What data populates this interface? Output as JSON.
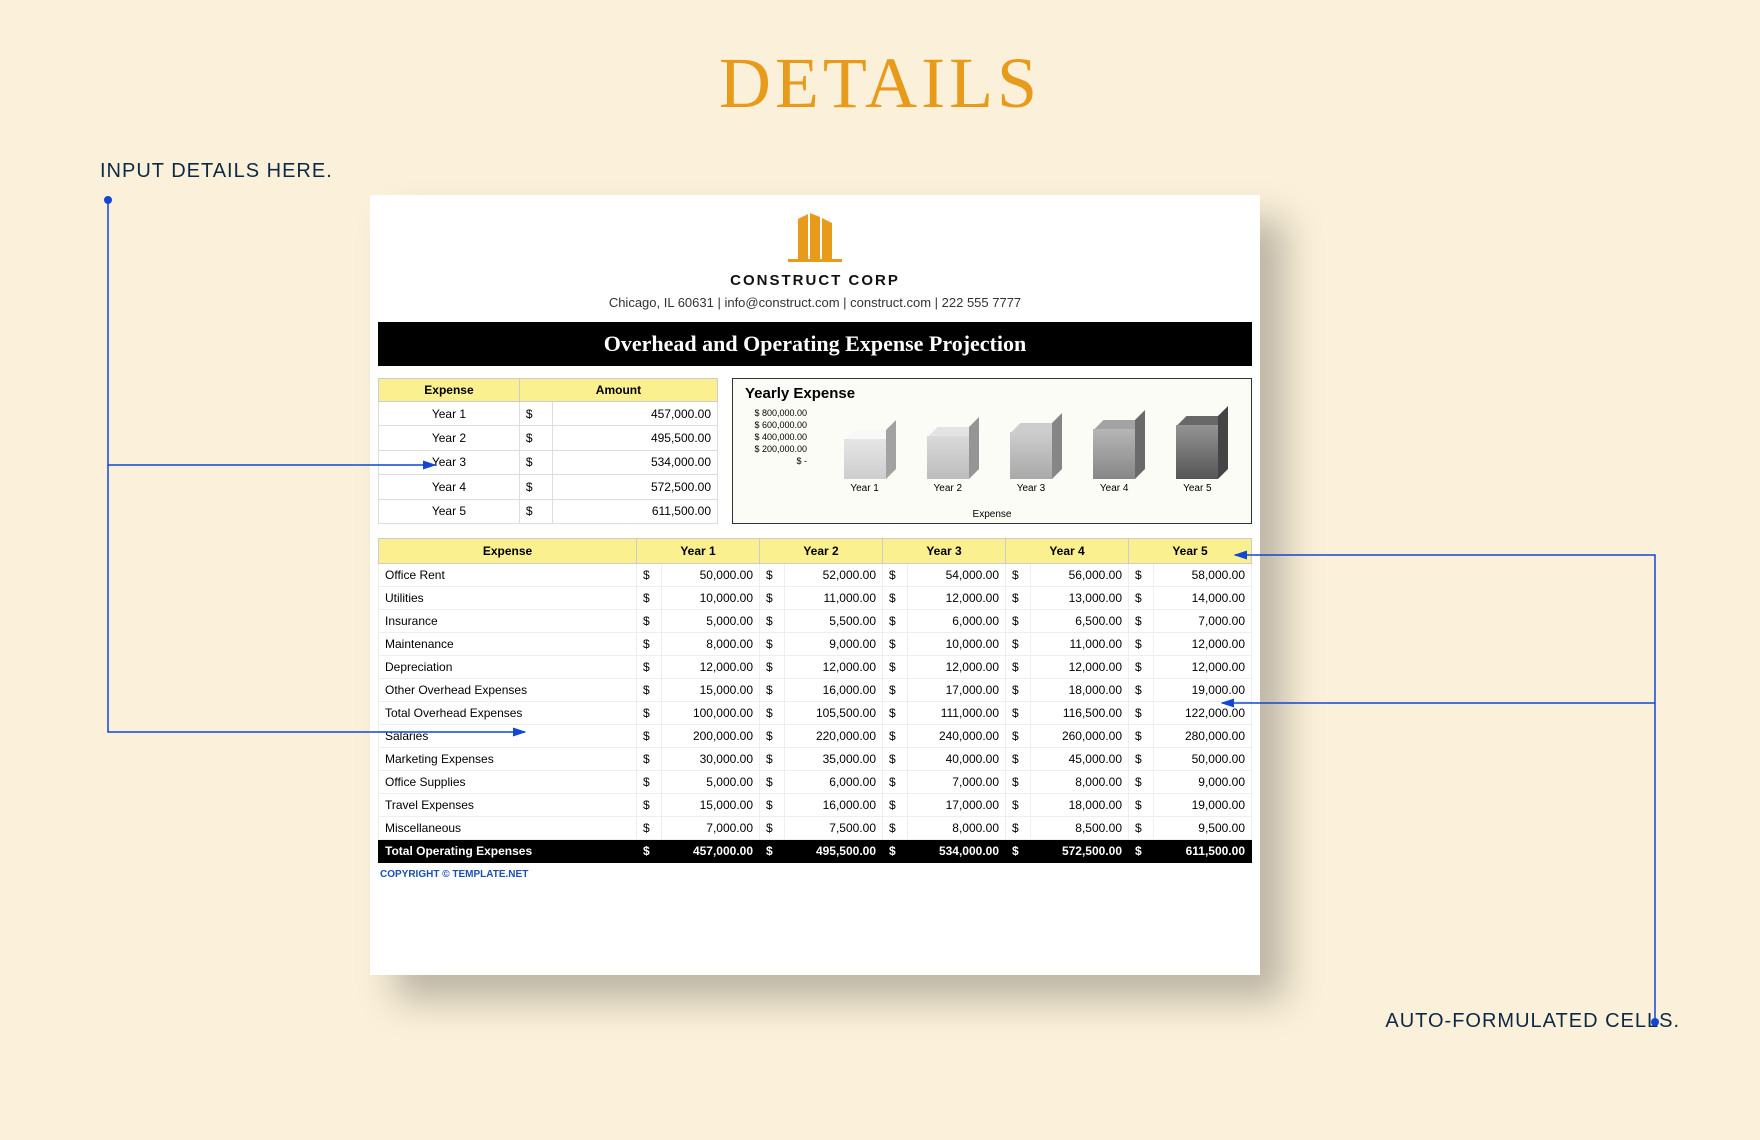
{
  "page": {
    "title": "DETAILS"
  },
  "annotations": {
    "input": "INPUT DETAILS HERE.",
    "auto": "AUTO-FORMULATED CELLS."
  },
  "company": {
    "name": "CONSTRUCT CORP",
    "line": "Chicago, IL 60631  |  info@construct.com  |  construct.com  |  222 555 7777"
  },
  "titleBar": "Overhead and Operating Expense Projection",
  "yearly": {
    "headers": {
      "expense": "Expense",
      "amount": "Amount"
    },
    "rows": [
      {
        "label": "Year 1",
        "amount": "457,000.00"
      },
      {
        "label": "Year 2",
        "amount": "495,500.00"
      },
      {
        "label": "Year 3",
        "amount": "534,000.00"
      },
      {
        "label": "Year 4",
        "amount": "572,500.00"
      },
      {
        "label": "Year 5",
        "amount": "611,500.00"
      }
    ]
  },
  "chart": {
    "title": "Yearly Expense",
    "sub": "Expense",
    "ticks": [
      "$ 800,000.00",
      "$ 600,000.00",
      "$ 400,000.00",
      "$ 200,000.00",
      "$ -"
    ]
  },
  "chart_data": {
    "type": "bar",
    "title": "Yearly Expense",
    "categories": [
      "Year 1",
      "Year 2",
      "Year 3",
      "Year 4",
      "Year 5"
    ],
    "values": [
      457000,
      495500,
      534000,
      572500,
      611500
    ],
    "ylabel": "Expense",
    "xlabel": "",
    "ylim": [
      0,
      800000
    ]
  },
  "detail": {
    "headers": [
      "Expense",
      "Year 1",
      "Year 2",
      "Year 3",
      "Year 4",
      "Year 5"
    ],
    "rows": [
      {
        "name": "Office Rent",
        "v": [
          "50,000.00",
          "52,000.00",
          "54,000.00",
          "56,000.00",
          "58,000.00"
        ]
      },
      {
        "name": "Utilities",
        "v": [
          "10,000.00",
          "11,000.00",
          "12,000.00",
          "13,000.00",
          "14,000.00"
        ]
      },
      {
        "name": "Insurance",
        "v": [
          "5,000.00",
          "5,500.00",
          "6,000.00",
          "6,500.00",
          "7,000.00"
        ]
      },
      {
        "name": "Maintenance",
        "v": [
          "8,000.00",
          "9,000.00",
          "10,000.00",
          "11,000.00",
          "12,000.00"
        ]
      },
      {
        "name": "Depreciation",
        "v": [
          "12,000.00",
          "12,000.00",
          "12,000.00",
          "12,000.00",
          "12,000.00"
        ]
      },
      {
        "name": "Other Overhead Expenses",
        "v": [
          "15,000.00",
          "16,000.00",
          "17,000.00",
          "18,000.00",
          "19,000.00"
        ]
      },
      {
        "name": "Total Overhead Expenses",
        "v": [
          "100,000.00",
          "105,500.00",
          "111,000.00",
          "116,500.00",
          "122,000.00"
        ]
      },
      {
        "name": "Salaries",
        "v": [
          "200,000.00",
          "220,000.00",
          "240,000.00",
          "260,000.00",
          "280,000.00"
        ]
      },
      {
        "name": "Marketing Expenses",
        "v": [
          "30,000.00",
          "35,000.00",
          "40,000.00",
          "45,000.00",
          "50,000.00"
        ]
      },
      {
        "name": "Office Supplies",
        "v": [
          "5,000.00",
          "6,000.00",
          "7,000.00",
          "8,000.00",
          "9,000.00"
        ]
      },
      {
        "name": "Travel Expenses",
        "v": [
          "15,000.00",
          "16,000.00",
          "17,000.00",
          "18,000.00",
          "19,000.00"
        ]
      },
      {
        "name": "Miscellaneous",
        "v": [
          "7,000.00",
          "7,500.00",
          "8,000.00",
          "8,500.00",
          "9,500.00"
        ]
      }
    ],
    "total": {
      "name": "Total Operating Expenses",
      "v": [
        "457,000.00",
        "495,500.00",
        "534,000.00",
        "572,500.00",
        "611,500.00"
      ]
    }
  },
  "copyright": "COPYRIGHT © TEMPLATE.NET"
}
